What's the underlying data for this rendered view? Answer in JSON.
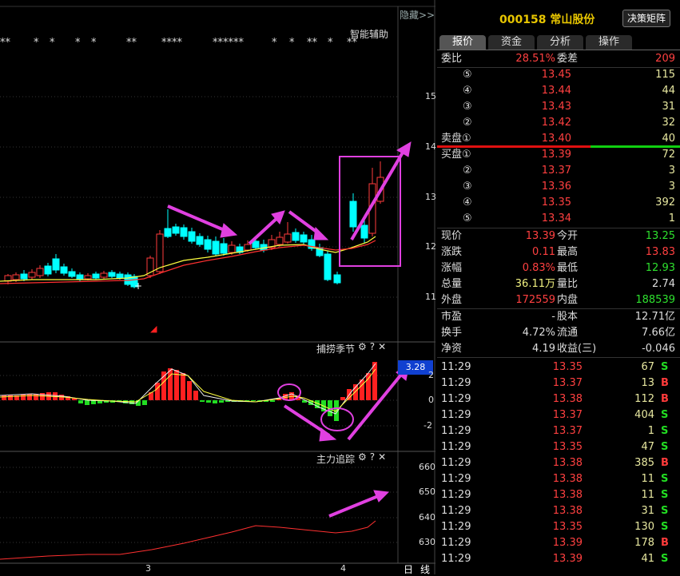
{
  "chart": {
    "hide_label": "隐藏>>",
    "smart_assist": "智能辅助",
    "stars": [
      "**",
      "*",
      "*",
      "*",
      "*",
      "**",
      "****",
      "******",
      "*",
      "*",
      "**",
      "*",
      "**"
    ],
    "price_axis": [
      "15",
      "14",
      "13",
      "12",
      "11"
    ],
    "x_labels": [
      "3",
      "4"
    ],
    "period_label": "日",
    "line_label": "线",
    "indicator1": {
      "title": "捕捞季节",
      "value_badge": "3.28",
      "axis": [
        "2",
        "0",
        "-2"
      ]
    },
    "indicator2": {
      "title": "主力追踪",
      "axis": [
        "660",
        "650",
        "640",
        "630"
      ]
    },
    "icons": {
      "settings": "⚙",
      "help": "?",
      "close": "✕"
    }
  },
  "panel": {
    "code": "000158",
    "name": "常山股份",
    "decision_button": "决策矩阵",
    "tabs": [
      "报价",
      "资金",
      "分析",
      "操作"
    ],
    "ratio": {
      "label": "委比",
      "value": "28.51%",
      "diff_label": "委差",
      "diff": "209"
    },
    "sells": [
      {
        "level": "⑤",
        "price": "13.45",
        "vol": "115"
      },
      {
        "level": "④",
        "price": "13.44",
        "vol": "44"
      },
      {
        "level": "③",
        "price": "13.43",
        "vol": "31"
      },
      {
        "level": "②",
        "price": "13.42",
        "vol": "32"
      },
      {
        "level": "卖盘①",
        "price": "13.40",
        "vol": "40"
      }
    ],
    "buys": [
      {
        "level": "买盘①",
        "price": "13.39",
        "vol": "72"
      },
      {
        "level": "②",
        "price": "13.37",
        "vol": "3"
      },
      {
        "level": "③",
        "price": "13.36",
        "vol": "3"
      },
      {
        "level": "④",
        "price": "13.35",
        "vol": "392"
      },
      {
        "level": "⑤",
        "price": "13.34",
        "vol": "1"
      }
    ],
    "stats": [
      {
        "l1": "现价",
        "v1": "13.39",
        "l2": "今开",
        "v2": "13.25"
      },
      {
        "l1": "涨跌",
        "v1": "0.11",
        "l2": "最高",
        "v2": "13.83"
      },
      {
        "l1": "涨幅",
        "v1": "0.83%",
        "l2": "最低",
        "v2": "12.93"
      },
      {
        "l1": "总量",
        "v1": "36.11万",
        "l2": "量比",
        "v2": "2.74"
      },
      {
        "l1": "外盘",
        "v1": "172559",
        "l2": "内盘",
        "v2": "188539"
      }
    ],
    "fund": [
      {
        "l1": "市盈",
        "v1": "-",
        "l2": "股本",
        "v2": "12.71亿"
      },
      {
        "l1": "换手",
        "v1": "4.72%",
        "l2": "流通",
        "v2": "7.66亿"
      },
      {
        "l1": "净资",
        "v1": "4.19",
        "l2": "收益(三)",
        "v2": "-0.046"
      }
    ],
    "ticks": [
      {
        "time": "11:29",
        "price": "13.35",
        "vol": "67",
        "side": "S"
      },
      {
        "time": "11:29",
        "price": "13.37",
        "vol": "13",
        "side": "B"
      },
      {
        "time": "11:29",
        "price": "13.38",
        "vol": "112",
        "side": "B"
      },
      {
        "time": "11:29",
        "price": "13.37",
        "vol": "404",
        "side": "S"
      },
      {
        "time": "11:29",
        "price": "13.37",
        "vol": "1",
        "side": "S"
      },
      {
        "time": "11:29",
        "price": "13.35",
        "vol": "47",
        "side": "S"
      },
      {
        "time": "11:29",
        "price": "13.38",
        "vol": "385",
        "side": "B"
      },
      {
        "time": "11:29",
        "price": "13.38",
        "vol": "11",
        "side": "S"
      },
      {
        "time": "11:29",
        "price": "13.38",
        "vol": "11",
        "side": "S"
      },
      {
        "time": "11:29",
        "price": "13.38",
        "vol": "31",
        "side": "S"
      },
      {
        "time": "11:29",
        "price": "13.35",
        "vol": "130",
        "side": "S"
      },
      {
        "time": "11:29",
        "price": "13.39",
        "vol": "178",
        "side": "B"
      },
      {
        "time": "11:29",
        "price": "13.39",
        "vol": "41",
        "side": "S"
      }
    ]
  },
  "colors": {
    "up": "#ff3b3b",
    "down": "#00ffff",
    "ma_yellow": "#ffff40",
    "ma_red": "#ff3030",
    "annot": "#e040e0",
    "green": "#22dd22"
  }
}
